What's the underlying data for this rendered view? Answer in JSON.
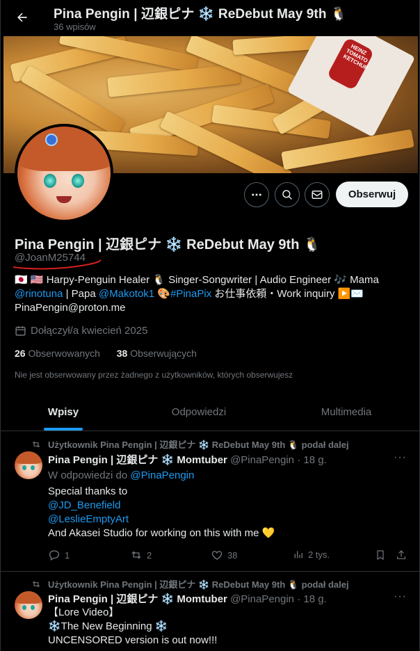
{
  "header": {
    "title": "Pina Pengin | 辺銀ピナ ❄️ ReDebut May 9th 🐧",
    "post_count": "36 wpisów"
  },
  "banner": {
    "packet_text": "HEINZ TOMATO KETCHUP"
  },
  "profile": {
    "name": "Pina Pengin | 辺銀ピナ ❄️ ReDebut May 9th 🐧",
    "handle": "@JoanM25744",
    "bio": {
      "line1": "🇯🇵 🇺🇸 Harpy-Penguin Healer 🐧 Singer-Songwriter | Audio Engineer 🎶 Mama",
      "mention1": "@rinotuna",
      "line2a": " | Papa ",
      "mention2": "@Makotok1",
      "line2b": " 🎨",
      "hashtag": "#PinaPix",
      "line2c": " お仕事依頼・Work inquiry ▶️✉️",
      "line3": "PinaPengin@proton.me"
    },
    "joined": "Dołączył/a kwiecień 2025",
    "following_count": "26",
    "following_label": "Obserwowanych",
    "followers_count": "38",
    "followers_label": "Obserwujących",
    "mutuals": "Nie jest obserwowany przez żadnego z użytkowników, których obserwujesz"
  },
  "buttons": {
    "follow": "Obserwuj"
  },
  "tabs": [
    {
      "label": "Wpisy"
    },
    {
      "label": "Odpowiedzi"
    },
    {
      "label": "Multimedia"
    }
  ],
  "posts": [
    {
      "repost": "Użytkownik Pina Pengin | 辺銀ピナ ❄️ ReDebut May 9th 🐧 podał dalej",
      "author": "Pina Pengin | 辺銀ピナ ❄️ Momtuber",
      "handle": "@PinaPengin",
      "time": "· 18 g.",
      "reply_prefix": "W odpowiedzi do ",
      "reply_to": "@PinaPengin",
      "text1": "Special thanks to",
      "mention1": "@JD_Benefield",
      "mention2": "@LeslieEmptyArt",
      "text2": "And Akasei Studio for working on this with me 💛",
      "replies": "1",
      "reposts": "2",
      "likes": "38",
      "views": "2 tys."
    },
    {
      "repost": "Użytkownik Pina Pengin | 辺銀ピナ ❄️ ReDebut May 9th 🐧 podał dalej",
      "author": "Pina Pengin | 辺銀ピナ ❄️ Momtuber",
      "handle": "@PinaPengin",
      "time": "· 18 g.",
      "line1": "【Lore Video】",
      "line2": "❄️The New Beginning ❄️",
      "line3": "UNCENSORED version is out now!!!"
    }
  ],
  "colors": {
    "accent": "#1d9bf0",
    "background": "#000000",
    "underline": "#d6201f"
  }
}
